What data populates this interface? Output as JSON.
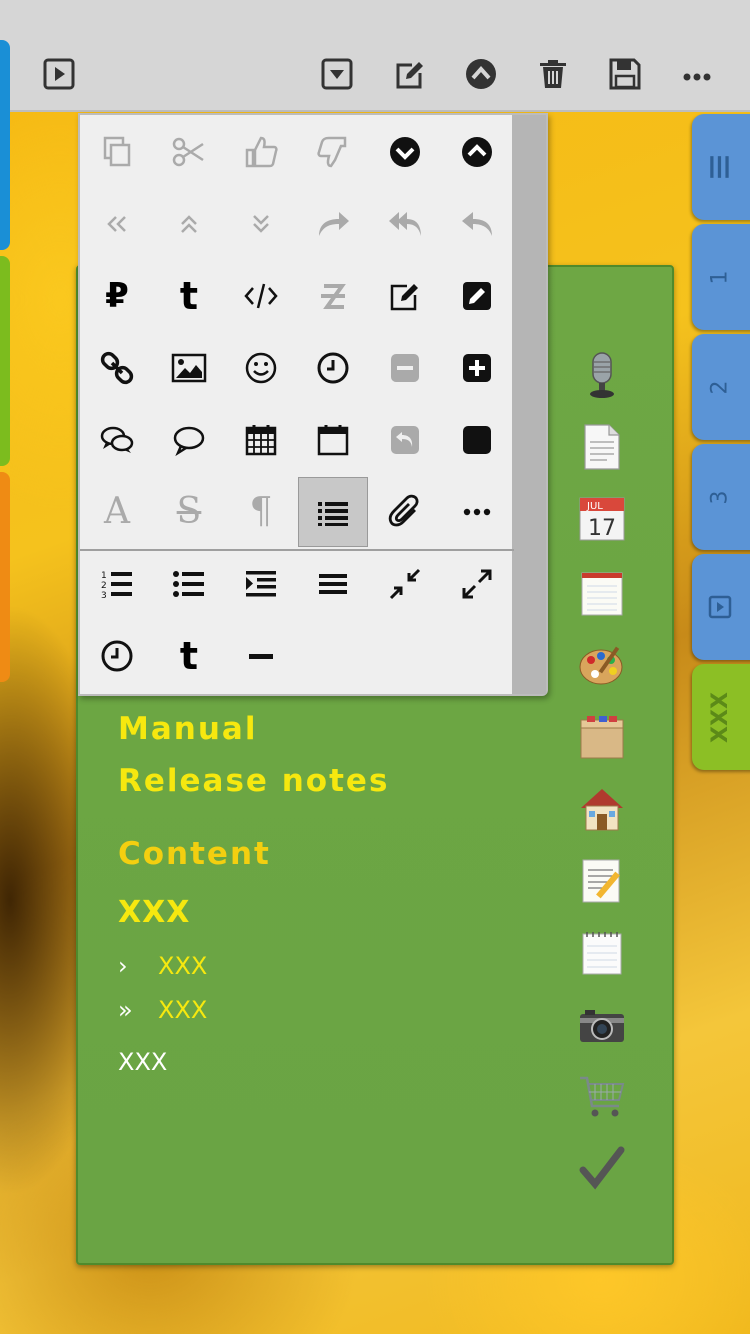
{
  "toolbar": {
    "left_button": "play-box-icon",
    "right_buttons": [
      "dropdown-icon",
      "edit-icon",
      "chevron-up-circle-icon",
      "trash-icon",
      "save-icon",
      "more-icon"
    ]
  },
  "colors": {
    "toolbar_bg": "#d6d6d6",
    "panel_green": "#6ca643",
    "menu_yellow": "#f6e80f",
    "tab_blue": "#5a93d4",
    "tab_green": "#8cbf25"
  },
  "right_tabs": [
    {
      "label": "|||",
      "icon": "menu-icon"
    },
    {
      "label": "1"
    },
    {
      "label": "2"
    },
    {
      "label": "3"
    },
    {
      "label": "",
      "icon": "play-box-icon"
    },
    {
      "label": "XXX",
      "active": true
    }
  ],
  "menu": {
    "manual": "Manual",
    "release_notes": "Release notes",
    "content": "Content",
    "heading": "XXX",
    "item1_chevron": "›",
    "item1": "XXX",
    "item2_chevron": "»",
    "item2": "XXX",
    "item3": "XXX"
  },
  "side_icons": [
    "microphone-icon",
    "document-icon",
    "calendar-icon",
    "notepad-icon",
    "palette-icon",
    "box-icon",
    "house-icon",
    "note-pencil-icon",
    "notebook-icon",
    "camera-icon",
    "cart-icon",
    "checkmark-icon"
  ],
  "calendar": {
    "month": "JUL",
    "day": "17"
  },
  "popup": {
    "rows": [
      [
        "copy-icon",
        "scissors-icon",
        "thumb-up-icon",
        "thumb-down-icon",
        "arrow-down-circle-icon",
        "arrow-up-circle-icon"
      ],
      [
        "double-left-icon",
        "double-up-icon",
        "double-down-icon",
        "redo-icon",
        "reply-all-icon",
        "reply-icon"
      ],
      [
        "ruble-icon",
        "tumblr-icon",
        "code-icon",
        "strike-icon",
        "edit-square-icon",
        "pencil-square-icon"
      ],
      [
        "link-icon",
        "image-icon",
        "smile-icon",
        "clock-icon",
        "minus-square-icon",
        "plus-square-icon"
      ],
      [
        "comments-icon",
        "comment-icon",
        "calendar-grid-icon",
        "calendar-empty-icon",
        "undo-square-icon",
        "black-square-icon"
      ],
      [
        "font-icon",
        "strikethrough-icon",
        "paragraph-icon",
        "list-icon",
        "paperclip-icon",
        "ellipsis-icon"
      ],
      [
        "ordered-list-icon",
        "bullet-list-icon",
        "indent-icon",
        "align-justify-icon",
        "compress-icon",
        "expand-icon"
      ],
      [
        "clock-icon",
        "tumblr-icon",
        "horizontal-rule-icon"
      ]
    ],
    "glyph_text": {
      "ruble": "₽",
      "tumblr": "t",
      "font": "A",
      "strike": "S",
      "paragraph": "¶"
    }
  }
}
